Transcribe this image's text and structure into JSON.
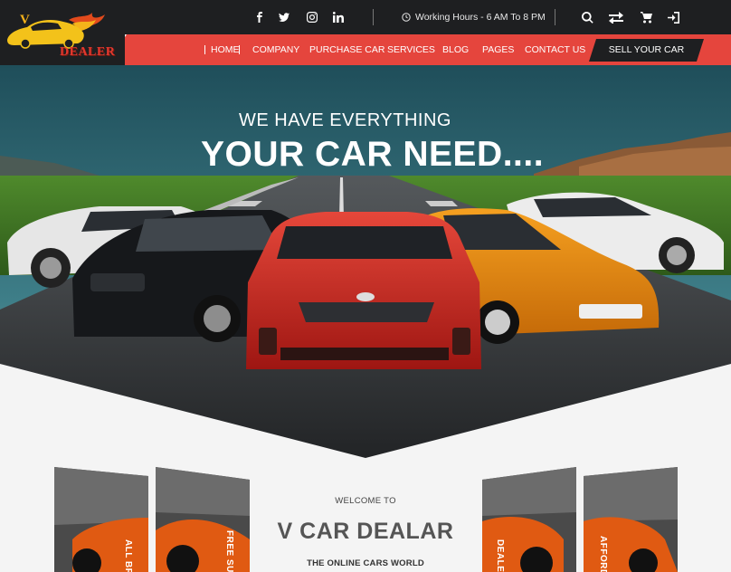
{
  "logo": {
    "letter": "V",
    "brand": "DEALER"
  },
  "topbar": {
    "social": [
      "facebook-icon",
      "twitter-icon",
      "instagram-icon",
      "linkedin-icon"
    ],
    "hours": "Working Hours - 6 AM To 8 PM",
    "tools": [
      "search-icon",
      "compare-icon",
      "cart-icon",
      "login-icon"
    ]
  },
  "nav": {
    "items": [
      "HOME",
      "COMPANY",
      "PURCHASE CAR",
      "SERVICES",
      "BLOG",
      "PAGES",
      "CONTACT US"
    ],
    "cta": "SELL YOUR CAR"
  },
  "hero": {
    "line1": "WE HAVE EVERYTHING",
    "line2": "YOUR CAR NEED...."
  },
  "features": [
    "ALL BRA",
    "FREE SUPP",
    "DEALER",
    "AFFORD"
  ],
  "welcome": {
    "small": "WELCOME TO",
    "title": "V  CAR DEALAR",
    "subtitle": "THE ONLINE CARS WORLD"
  },
  "colors": {
    "dark": "#1e1f21",
    "accent": "#e5453d"
  }
}
